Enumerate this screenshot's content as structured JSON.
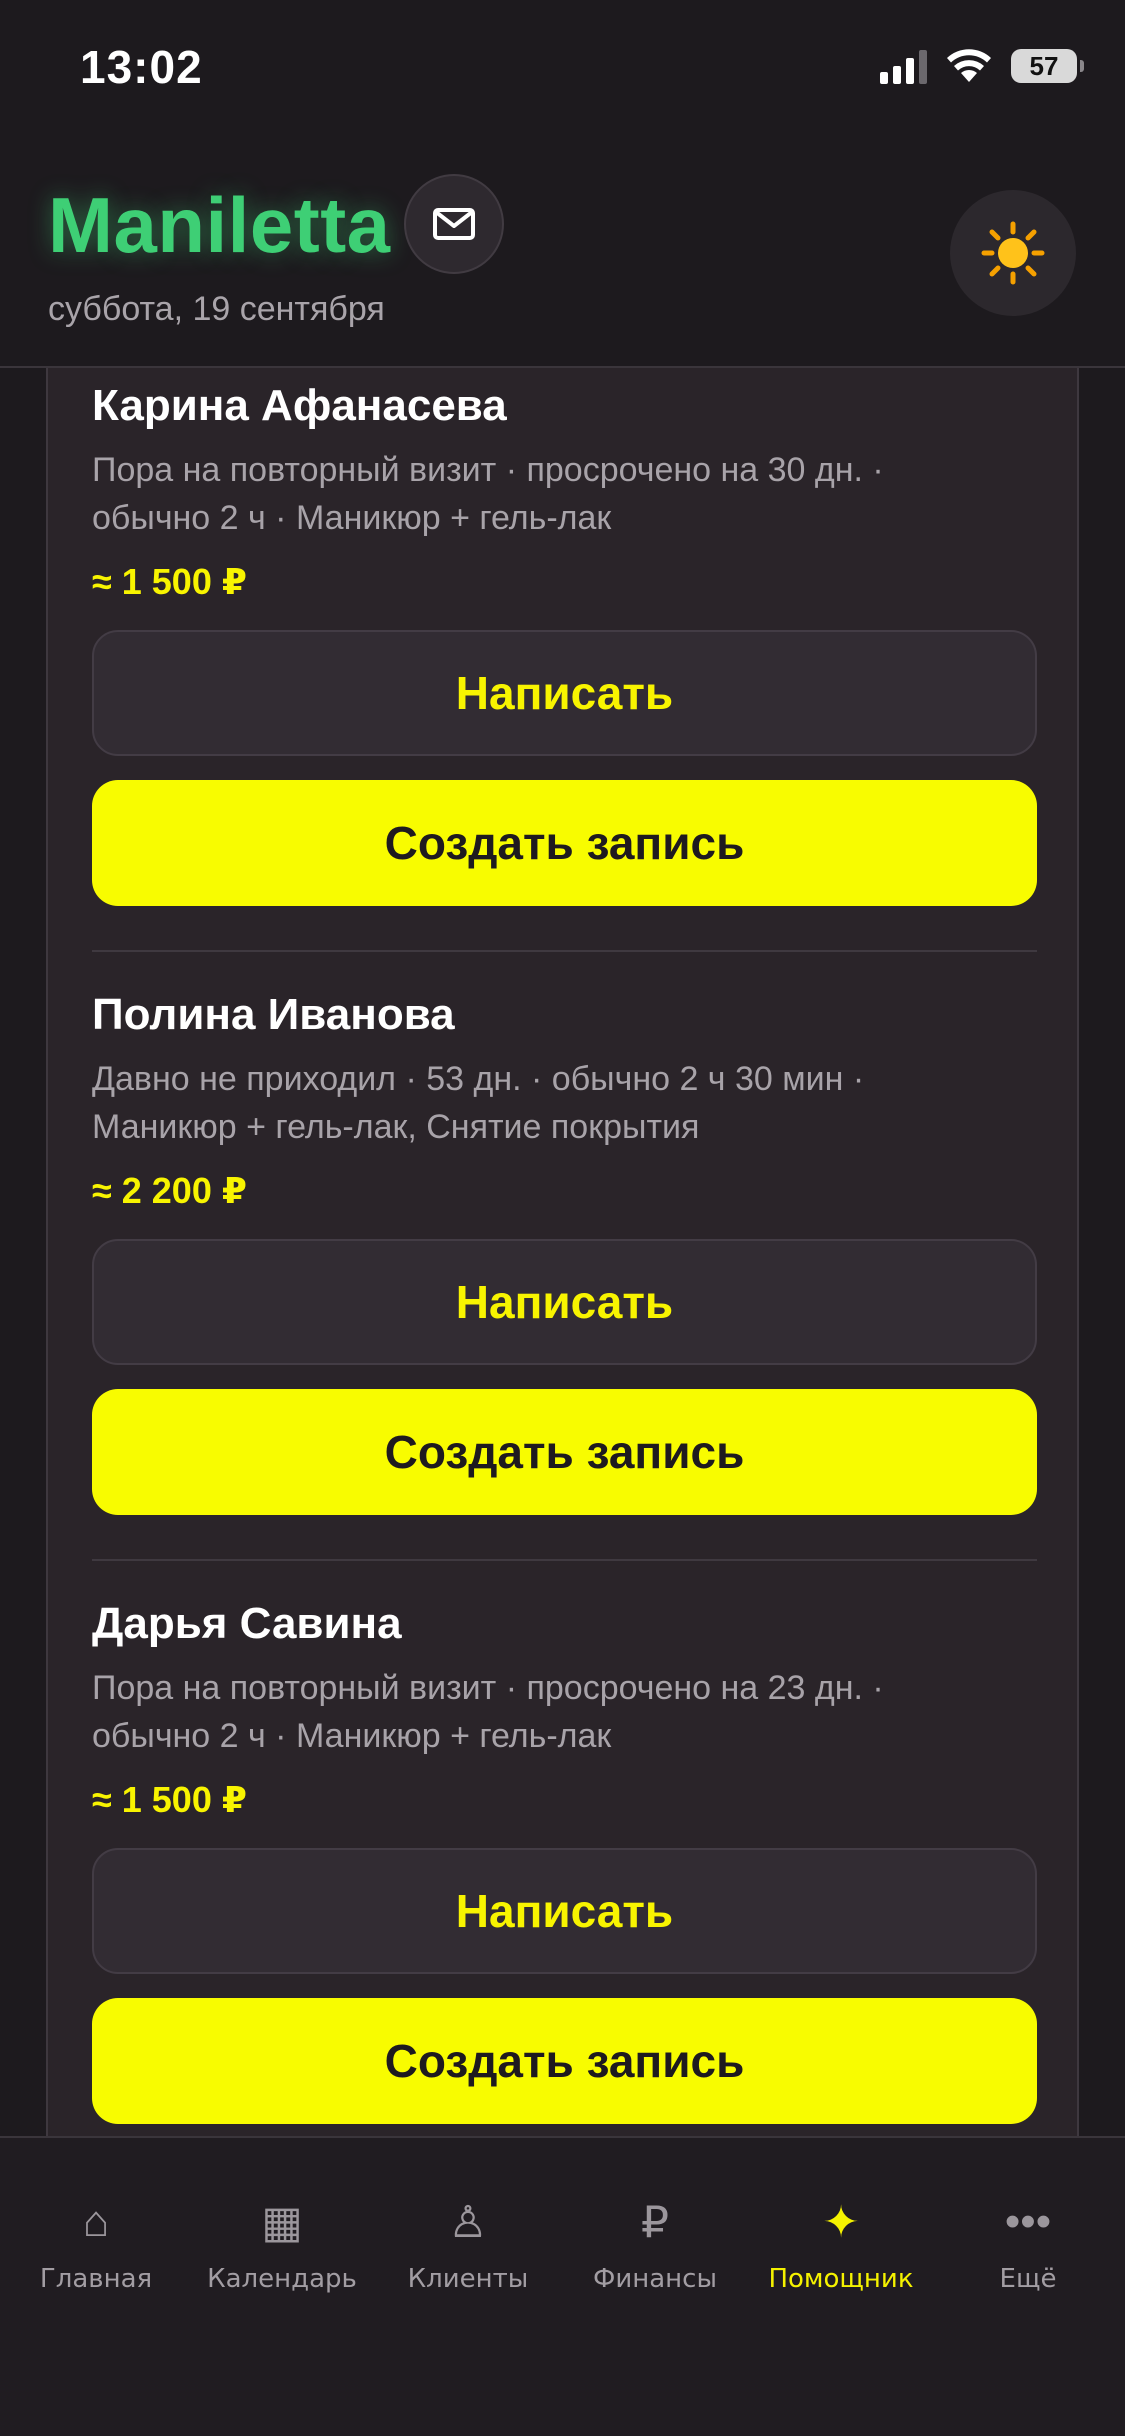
{
  "status": {
    "time": "13:02",
    "battery": "57"
  },
  "header": {
    "title": "Maniletta",
    "date": "суббота, 19 сентября"
  },
  "entries": [
    {
      "name": "Карина Афанасева",
      "desc_line1": "Пора на повторный визит · просрочено на 30 дн. ·",
      "desc_line2": "обычно 2 ч · Маникюр + гель-лак",
      "price": "≈ 1 500 ₽",
      "write_label": "Написать",
      "create_label": "Создать запись"
    },
    {
      "name": "Полина Иванова",
      "desc_line1": "Давно не приходил · 53 дн. · обычно 2 ч 30 мин ·",
      "desc_line2": "Маникюр + гель-лак, Снятие покрытия",
      "price": "≈ 2 200 ₽",
      "write_label": "Написать",
      "create_label": "Создать запись"
    },
    {
      "name": "Дарья Савина",
      "desc_line1": "Пора на повторный визит · просрочено на 23 дн. ·",
      "desc_line2": "обычно 2 ч · Маникюр + гель-лак",
      "price": "≈ 1 500 ₽",
      "write_label": "Написать",
      "create_label": "Создать запись"
    }
  ],
  "nav": [
    {
      "label": "Главная",
      "icon": "home-icon",
      "glyph": "⌂"
    },
    {
      "label": "Календарь",
      "icon": "calendar-icon",
      "glyph": "▦"
    },
    {
      "label": "Клиенты",
      "icon": "person-icon",
      "glyph": "♙"
    },
    {
      "label": "Финансы",
      "icon": "ruble-icon",
      "glyph": "₽"
    },
    {
      "label": "Помощник",
      "icon": "sparkle-icon",
      "glyph": "✦"
    },
    {
      "label": "Ещё",
      "icon": "more-icon",
      "glyph": "•••"
    }
  ],
  "colors": {
    "accent": "#f8fc00",
    "brand": "#3ecf75",
    "background": "#1d1a1e"
  }
}
